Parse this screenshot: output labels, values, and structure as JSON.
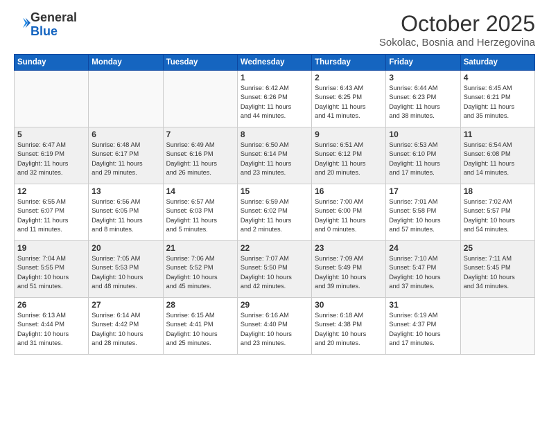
{
  "logo": {
    "general": "General",
    "blue": "Blue"
  },
  "header": {
    "month": "October 2025",
    "location": "Sokolac, Bosnia and Herzegovina"
  },
  "weekdays": [
    "Sunday",
    "Monday",
    "Tuesday",
    "Wednesday",
    "Thursday",
    "Friday",
    "Saturday"
  ],
  "weeks": [
    [
      {
        "day": "",
        "text": ""
      },
      {
        "day": "",
        "text": ""
      },
      {
        "day": "",
        "text": ""
      },
      {
        "day": "1",
        "text": "Sunrise: 6:42 AM\nSunset: 6:26 PM\nDaylight: 11 hours\nand 44 minutes."
      },
      {
        "day": "2",
        "text": "Sunrise: 6:43 AM\nSunset: 6:25 PM\nDaylight: 11 hours\nand 41 minutes."
      },
      {
        "day": "3",
        "text": "Sunrise: 6:44 AM\nSunset: 6:23 PM\nDaylight: 11 hours\nand 38 minutes."
      },
      {
        "day": "4",
        "text": "Sunrise: 6:45 AM\nSunset: 6:21 PM\nDaylight: 11 hours\nand 35 minutes."
      }
    ],
    [
      {
        "day": "5",
        "text": "Sunrise: 6:47 AM\nSunset: 6:19 PM\nDaylight: 11 hours\nand 32 minutes."
      },
      {
        "day": "6",
        "text": "Sunrise: 6:48 AM\nSunset: 6:17 PM\nDaylight: 11 hours\nand 29 minutes."
      },
      {
        "day": "7",
        "text": "Sunrise: 6:49 AM\nSunset: 6:16 PM\nDaylight: 11 hours\nand 26 minutes."
      },
      {
        "day": "8",
        "text": "Sunrise: 6:50 AM\nSunset: 6:14 PM\nDaylight: 11 hours\nand 23 minutes."
      },
      {
        "day": "9",
        "text": "Sunrise: 6:51 AM\nSunset: 6:12 PM\nDaylight: 11 hours\nand 20 minutes."
      },
      {
        "day": "10",
        "text": "Sunrise: 6:53 AM\nSunset: 6:10 PM\nDaylight: 11 hours\nand 17 minutes."
      },
      {
        "day": "11",
        "text": "Sunrise: 6:54 AM\nSunset: 6:08 PM\nDaylight: 11 hours\nand 14 minutes."
      }
    ],
    [
      {
        "day": "12",
        "text": "Sunrise: 6:55 AM\nSunset: 6:07 PM\nDaylight: 11 hours\nand 11 minutes."
      },
      {
        "day": "13",
        "text": "Sunrise: 6:56 AM\nSunset: 6:05 PM\nDaylight: 11 hours\nand 8 minutes."
      },
      {
        "day": "14",
        "text": "Sunrise: 6:57 AM\nSunset: 6:03 PM\nDaylight: 11 hours\nand 5 minutes."
      },
      {
        "day": "15",
        "text": "Sunrise: 6:59 AM\nSunset: 6:02 PM\nDaylight: 11 hours\nand 2 minutes."
      },
      {
        "day": "16",
        "text": "Sunrise: 7:00 AM\nSunset: 6:00 PM\nDaylight: 11 hours\nand 0 minutes."
      },
      {
        "day": "17",
        "text": "Sunrise: 7:01 AM\nSunset: 5:58 PM\nDaylight: 10 hours\nand 57 minutes."
      },
      {
        "day": "18",
        "text": "Sunrise: 7:02 AM\nSunset: 5:57 PM\nDaylight: 10 hours\nand 54 minutes."
      }
    ],
    [
      {
        "day": "19",
        "text": "Sunrise: 7:04 AM\nSunset: 5:55 PM\nDaylight: 10 hours\nand 51 minutes."
      },
      {
        "day": "20",
        "text": "Sunrise: 7:05 AM\nSunset: 5:53 PM\nDaylight: 10 hours\nand 48 minutes."
      },
      {
        "day": "21",
        "text": "Sunrise: 7:06 AM\nSunset: 5:52 PM\nDaylight: 10 hours\nand 45 minutes."
      },
      {
        "day": "22",
        "text": "Sunrise: 7:07 AM\nSunset: 5:50 PM\nDaylight: 10 hours\nand 42 minutes."
      },
      {
        "day": "23",
        "text": "Sunrise: 7:09 AM\nSunset: 5:49 PM\nDaylight: 10 hours\nand 39 minutes."
      },
      {
        "day": "24",
        "text": "Sunrise: 7:10 AM\nSunset: 5:47 PM\nDaylight: 10 hours\nand 37 minutes."
      },
      {
        "day": "25",
        "text": "Sunrise: 7:11 AM\nSunset: 5:45 PM\nDaylight: 10 hours\nand 34 minutes."
      }
    ],
    [
      {
        "day": "26",
        "text": "Sunrise: 6:13 AM\nSunset: 4:44 PM\nDaylight: 10 hours\nand 31 minutes."
      },
      {
        "day": "27",
        "text": "Sunrise: 6:14 AM\nSunset: 4:42 PM\nDaylight: 10 hours\nand 28 minutes."
      },
      {
        "day": "28",
        "text": "Sunrise: 6:15 AM\nSunset: 4:41 PM\nDaylight: 10 hours\nand 25 minutes."
      },
      {
        "day": "29",
        "text": "Sunrise: 6:16 AM\nSunset: 4:40 PM\nDaylight: 10 hours\nand 23 minutes."
      },
      {
        "day": "30",
        "text": "Sunrise: 6:18 AM\nSunset: 4:38 PM\nDaylight: 10 hours\nand 20 minutes."
      },
      {
        "day": "31",
        "text": "Sunrise: 6:19 AM\nSunset: 4:37 PM\nDaylight: 10 hours\nand 17 minutes."
      },
      {
        "day": "",
        "text": ""
      }
    ]
  ],
  "colors": {
    "header_bg": "#1565c0",
    "row_shade": "#f0f0f0"
  }
}
